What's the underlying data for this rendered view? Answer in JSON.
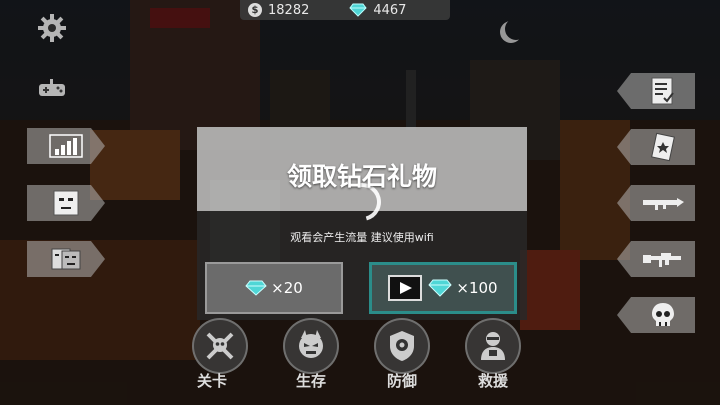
{
  "currency": {
    "coins": "18282",
    "diamonds": "4467",
    "coin_symbol": "$"
  },
  "dialog": {
    "title": "领取钻石礼物",
    "note": "观看会产生流量 建议使用wifi",
    "option_free": "×20",
    "option_video": "×100"
  },
  "bottom_menu": [
    {
      "label": "关卡",
      "icon": "crossed-axes-skull-icon"
    },
    {
      "label": "生存",
      "icon": "demon-face-icon"
    },
    {
      "label": "防御",
      "icon": "shield-eye-icon"
    },
    {
      "label": "救援",
      "icon": "survivor-icon"
    }
  ],
  "left_menu_icons": [
    "gear-icon",
    "gamepad-icon",
    "stats-bars-icon",
    "face-icon",
    "masks-icon"
  ],
  "right_menu_icons": [
    "checklist-icon",
    "card-icon",
    "rocket-launcher-icon",
    "rifle-icon",
    "skull-icon"
  ],
  "colors": {
    "diamond": "#4fd6d6",
    "selected_border": "#2b8d8a"
  }
}
